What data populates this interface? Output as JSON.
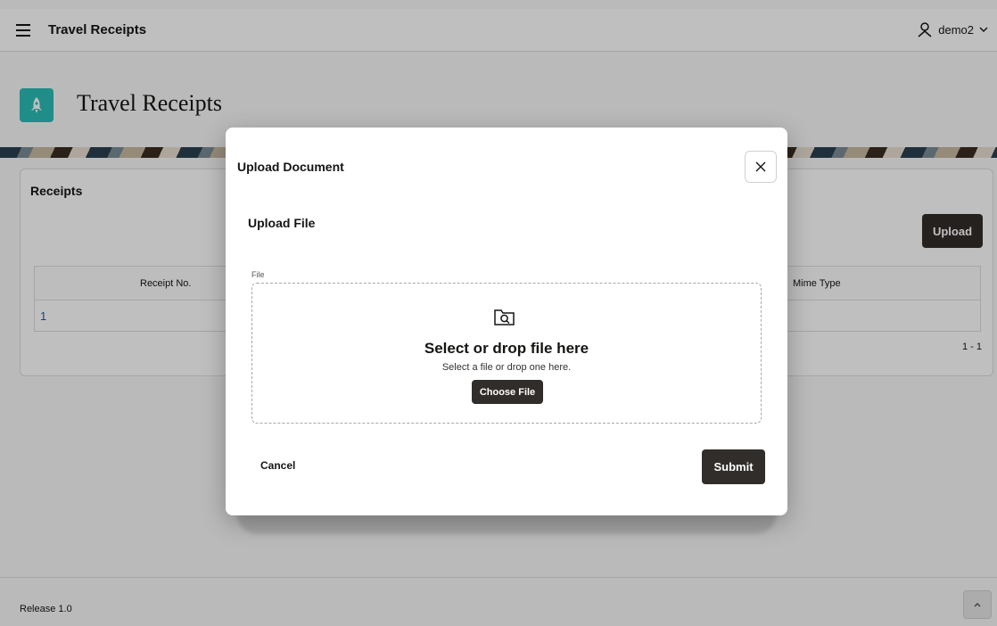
{
  "header": {
    "app_title": "Travel Receipts",
    "user_name": "demo2"
  },
  "page": {
    "title": "Travel Receipts"
  },
  "receipts": {
    "region_title": "Receipts",
    "upload_label": "Upload",
    "columns": [
      "Receipt No.",
      "Mime Type"
    ],
    "rows": [
      [
        "1",
        ""
      ]
    ],
    "pagination": "1 - 1"
  },
  "footer": {
    "release": "Release 1.0"
  },
  "dialog": {
    "title": "Upload Document",
    "section_title": "Upload File",
    "file_label": "File",
    "dropzone_heading": "Select or drop file here",
    "dropzone_sub": "Select a file or drop one here.",
    "choose_label": "Choose File",
    "cancel_label": "Cancel",
    "submit_label": "Submit"
  },
  "colors": {
    "accent": "#2bbdb6",
    "button_dark": "#312d2a"
  },
  "icons": [
    "menu-icon",
    "user-icon",
    "chevron-down-icon",
    "rocket-icon",
    "close-icon",
    "folder-search-icon",
    "chevron-up-icon"
  ]
}
